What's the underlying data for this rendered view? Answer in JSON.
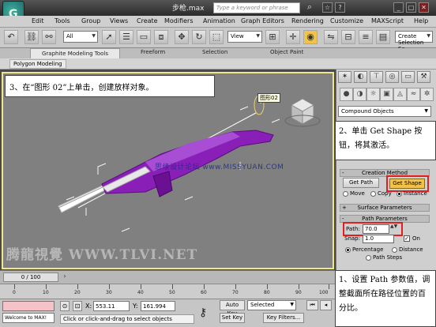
{
  "window": {
    "title": "步枪.max",
    "search_placeholder": "Type a keyword or phrase",
    "app_logo": "3ds-max-logo-icon"
  },
  "menu": [
    "Edit",
    "Tools",
    "Group",
    "Views",
    "Create",
    "Modifiers",
    "Animation",
    "Graph Editors",
    "Rendering",
    "Customize",
    "MAXScript",
    "Help"
  ],
  "toolbar": {
    "filter_value": "All",
    "view_value": "View",
    "named_selection_placeholder": "Create Selection Se"
  },
  "ribbon": {
    "tabs": [
      "Graphite Modeling Tools",
      "Freeform",
      "Selection",
      "Object Paint"
    ],
    "sub_tab": "Polygon Modeling"
  },
  "viewport": {
    "instruction_3": "3、在“图形 02”上单击，创建放样对象。",
    "tooltip": "图形02",
    "watermark_site": "思缘设计论坛 www.MISSYUAN.COM",
    "watermark_brand": "腾龍視覺 WWW.TLVI.NET"
  },
  "command_panel": {
    "category": "Compound Objects",
    "instruction_2": "2、单击 Get Shape 按钮，将其激活。",
    "creation_method_title": "Creation Method",
    "get_path_label": "Get Path",
    "get_shape_label": "Get Shape",
    "move_label": "Move",
    "copy_label": "Copy",
    "instance_label": "Instance",
    "surface_params_title": "Surface Parameters",
    "path_params_title": "Path Parameters",
    "path_label": "Path:",
    "path_value": "70.0",
    "snap_label": "Snap:",
    "snap_value": "1.0",
    "on_label": "On",
    "percentage_label": "Percentage",
    "distance_label": "Distance",
    "path_steps_label": "Path Steps",
    "instruction_1": "1、设置 Path 参数值，调整截面所在路径位置的百分比。"
  },
  "timeline": {
    "frame_display": "0 / 100",
    "ticks": [
      "0",
      "10",
      "20",
      "30",
      "40",
      "50",
      "60",
      "70",
      "80",
      "90",
      "100"
    ]
  },
  "status": {
    "welcome": "Welcome to MAX!",
    "prompt": "Click or click-and-drag to select objects",
    "x_label": "X:",
    "x_value": "553.11",
    "y_label": "Y:",
    "y_value": "161.994",
    "autokey_label": "Auto Key",
    "setkey_label": "Set Key",
    "selected_value": "Selected",
    "keyfilters_label": "Key Filters..."
  }
}
